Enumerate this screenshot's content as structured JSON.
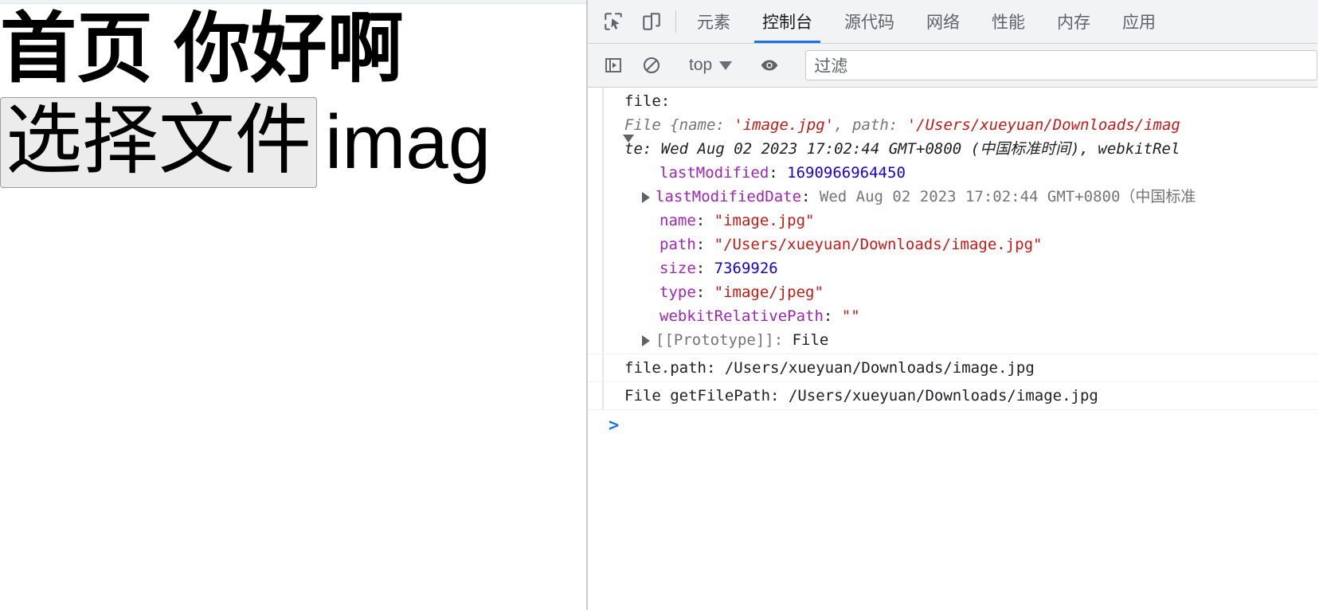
{
  "page": {
    "heading": "首页 你好啊",
    "file_input": {
      "button_label": "选择文件",
      "file_name": "imag"
    }
  },
  "devtools": {
    "toolbar": {
      "inspect_icon": "inspect-element-icon",
      "device_icon": "device-toolbar-icon",
      "tabs": [
        {
          "label": "元素",
          "active": false
        },
        {
          "label": "控制台",
          "active": true
        },
        {
          "label": "源代码",
          "active": false
        },
        {
          "label": "网络",
          "active": false
        },
        {
          "label": "性能",
          "active": false
        },
        {
          "label": "内存",
          "active": false
        },
        {
          "label": "应用",
          "active": false
        }
      ]
    },
    "filterbar": {
      "sidebar_icon": "console-sidebar-icon",
      "clear_icon": "clear-console-icon",
      "context": "top",
      "eye_icon": "live-expression-eye-icon",
      "filter_placeholder": "过滤"
    },
    "console": {
      "log1": {
        "label": "file:",
        "object_head": "File {",
        "k_name": "name",
        "v_name": "'image.jpg'",
        "sep1": ", ",
        "k_path": "path",
        "v_path": "'/Users/xueyuan/Downloads/imag",
        "wrap_line": "te: Wed Aug 02 2023 17:02:44 GMT+0800 (中国标准时间), webkitRel",
        "props": [
          {
            "key": "lastModified",
            "value": "1690966964450",
            "kind": "number",
            "expandable": false
          },
          {
            "key": "lastModifiedDate",
            "value": "Wed Aug 02 2023 17:02:44 GMT+0800（中国标准",
            "kind": "dim",
            "expandable": true
          },
          {
            "key": "name",
            "value": "\"image.jpg\"",
            "kind": "string",
            "expandable": false
          },
          {
            "key": "path",
            "value": "\"/Users/xueyuan/Downloads/image.jpg\"",
            "kind": "string",
            "expandable": false
          },
          {
            "key": "size",
            "value": "7369926",
            "kind": "number",
            "expandable": false
          },
          {
            "key": "type",
            "value": "\"image/jpeg\"",
            "kind": "string",
            "expandable": false
          },
          {
            "key": "webkitRelativePath",
            "value": "\"\"",
            "kind": "string",
            "expandable": false
          },
          {
            "key": "[[Prototype]]",
            "value": "File",
            "kind": "proto",
            "expandable": true
          }
        ]
      },
      "log2": "file.path:  /Users/xueyuan/Downloads/image.jpg",
      "log3": "File getFilePath: /Users/xueyuan/Downloads/image.jpg",
      "prompt": ">"
    }
  },
  "colors": {
    "accent": "#1a73e8",
    "toolbar_bg": "#f1f3f4",
    "string": "#c41a16",
    "number": "#1c00cf",
    "property": "#9c27b0",
    "dim": "#757575"
  }
}
